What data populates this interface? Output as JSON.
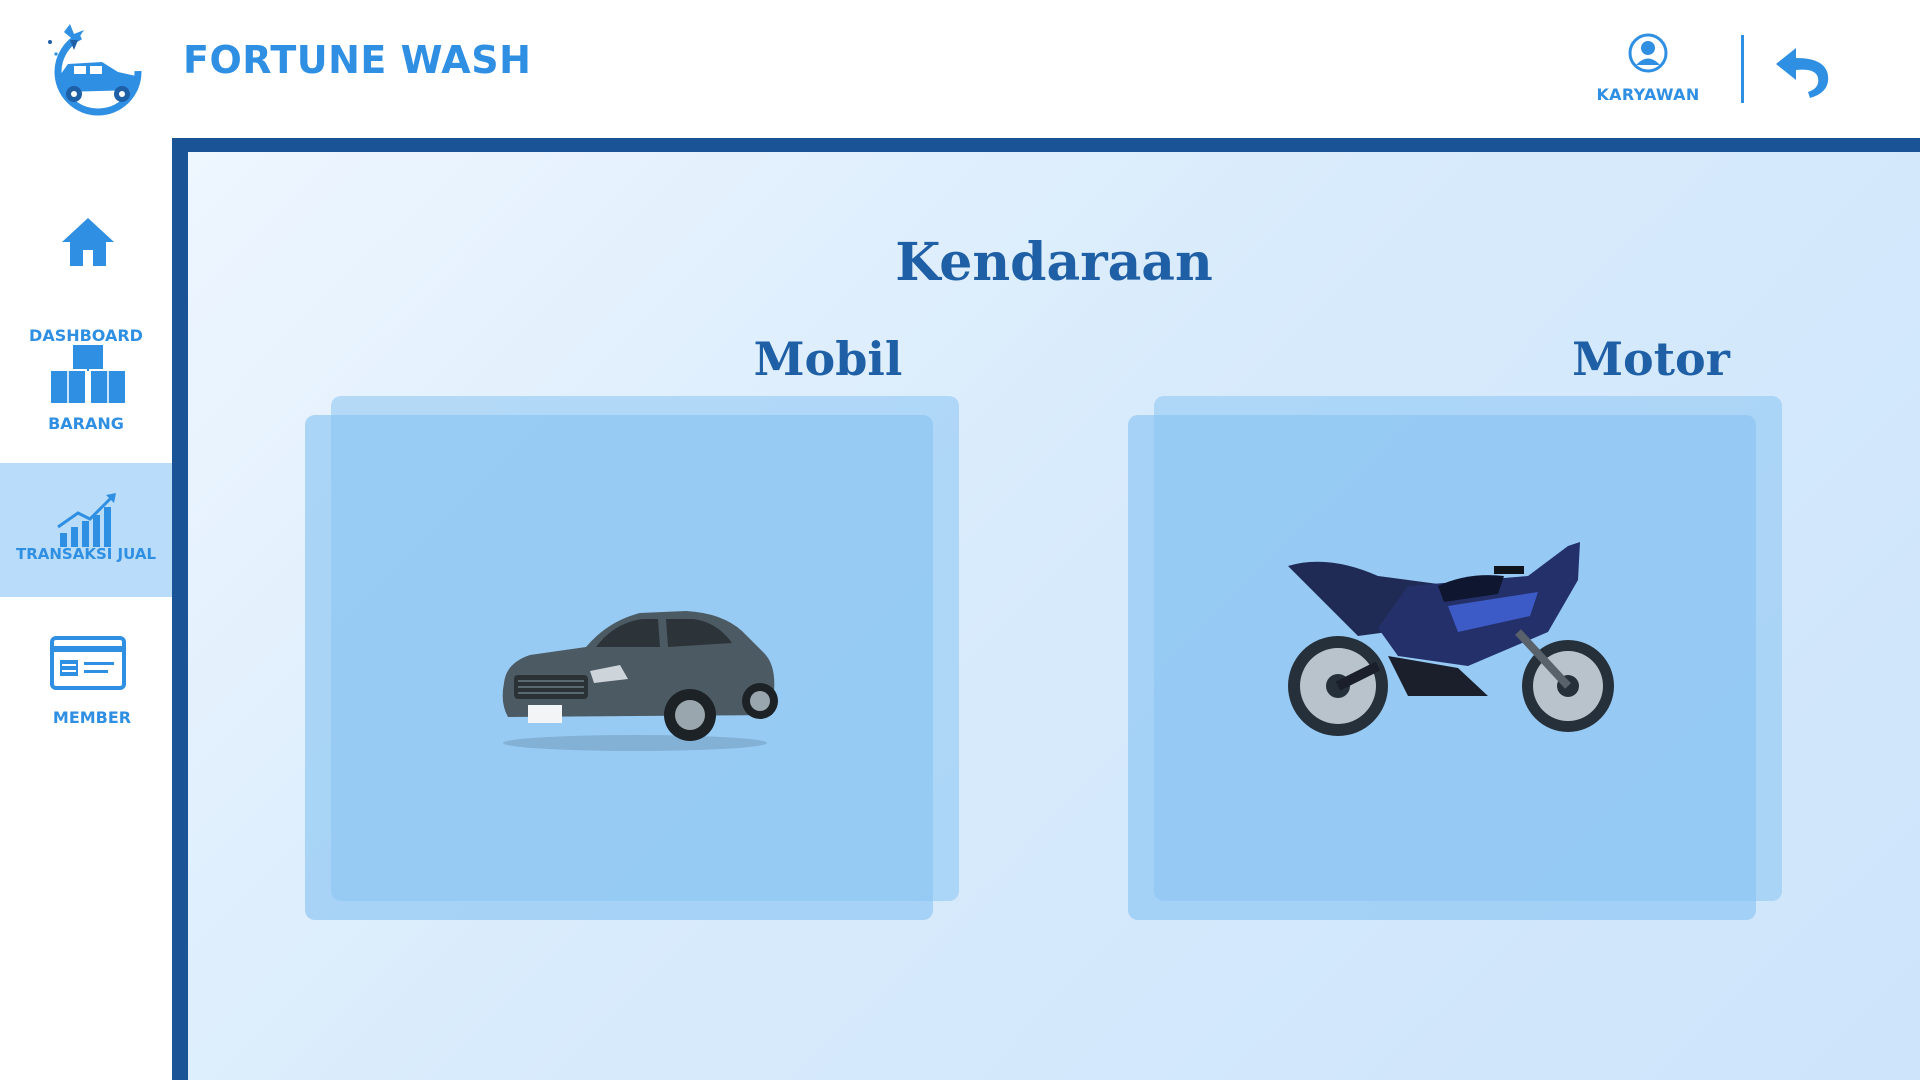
{
  "header": {
    "brand": "FORTUNE WASH",
    "user_label": "KARYAWAN",
    "user_icon": "user-circle-icon",
    "back_icon": "undo-arrow-icon",
    "logo_icon": "car-wash-logo-icon"
  },
  "sidebar": {
    "items": [
      {
        "label": "DASHBOARD",
        "icon": "home-icon",
        "active": false
      },
      {
        "label": "BARANG",
        "icon": "boxes-icon",
        "active": false
      },
      {
        "label": "TRANSAKSI JUAL",
        "icon": "bar-chart-growth-icon",
        "active": true
      },
      {
        "label": "MEMBER",
        "icon": "member-card-icon",
        "active": false
      }
    ]
  },
  "main": {
    "title": "Kendaraan",
    "options": [
      {
        "label": "Mobil",
        "image": "car-image"
      },
      {
        "label": "Motor",
        "image": "motorcycle-image"
      }
    ]
  },
  "colors": {
    "accent": "#2f8fe3",
    "title": "#1f5fa6",
    "frame": "#1a5497",
    "active_nav": "#b9dcfa",
    "card": "#8ac4f3"
  }
}
